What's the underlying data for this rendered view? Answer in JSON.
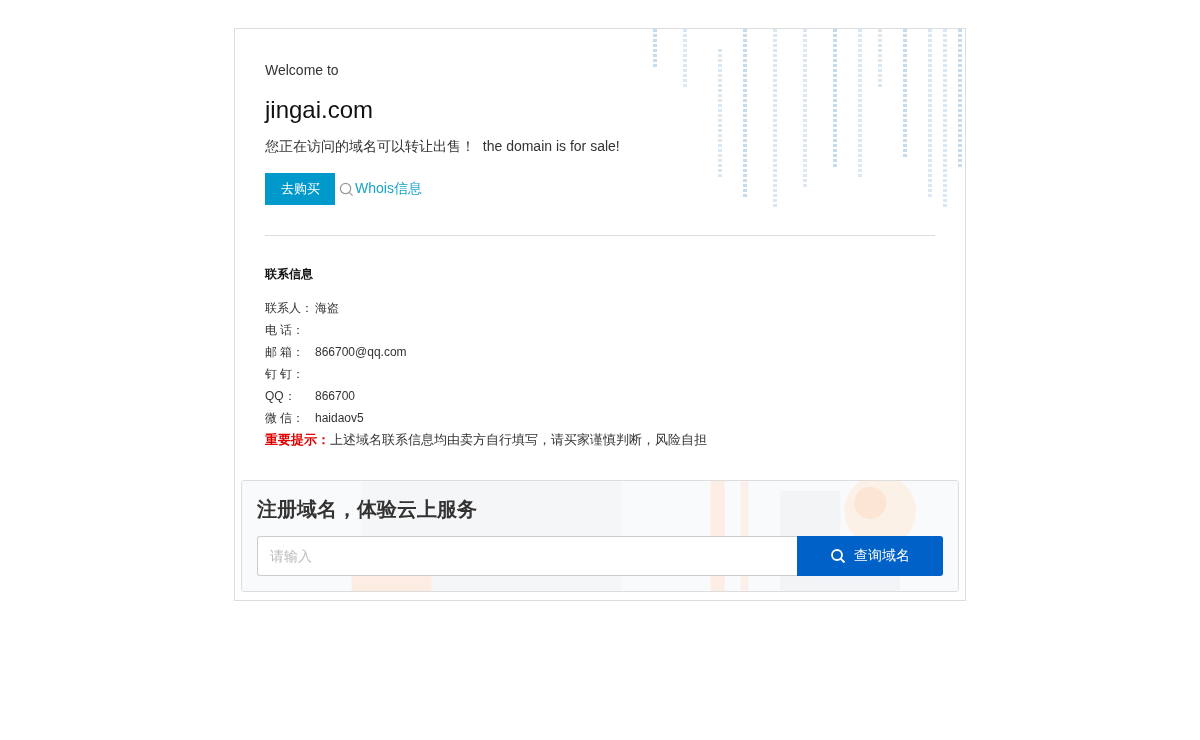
{
  "welcome": "Welcome to",
  "domain": "jingai.com",
  "sale_text": "您正在访问的域名可以转让出售！  the domain is for sale!",
  "buy_button": "去购买",
  "whois_link": "Whois信息",
  "contact": {
    "heading": "联系信息",
    "rows": [
      {
        "label": "联系人：",
        "value": "海盗"
      },
      {
        "label": "电 话："
      },
      {
        "label": "邮 箱：",
        "value": "866700@qq.com"
      },
      {
        "label": "钉 钉："
      },
      {
        "label": "QQ：",
        "value": "866700"
      },
      {
        "label": "微 信：",
        "value": "haidaov5"
      }
    ],
    "notice_label": "重要提示：",
    "notice_text": "上述域名联系信息均由卖方自行填写，请买家谨慎判断，风险自担"
  },
  "register": {
    "title": "注册域名，体验云上服务",
    "placeholder": "请输入",
    "button": "查询域名"
  }
}
